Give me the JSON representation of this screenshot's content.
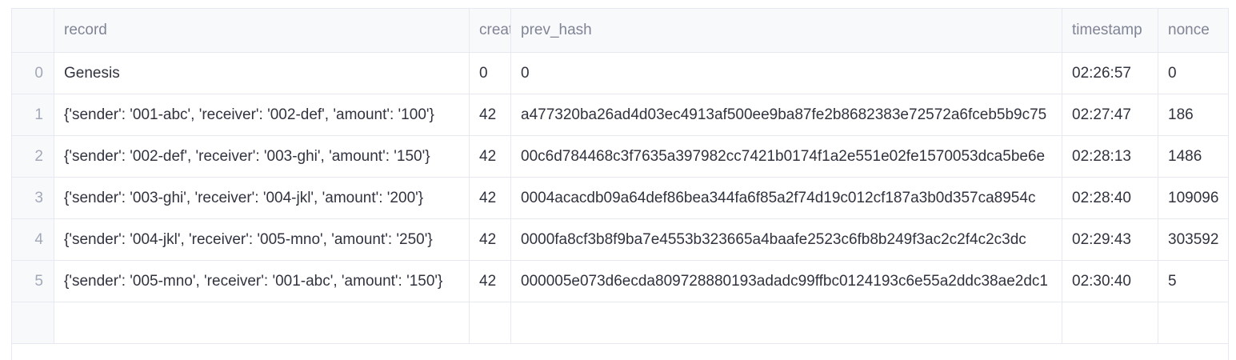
{
  "columns": [
    "",
    "record",
    "creat",
    "prev_hash",
    "timestamp",
    "nonce"
  ],
  "rows": [
    {
      "index": "0",
      "record": "Genesis",
      "creator": "0",
      "prev_hash": "0",
      "timestamp": "02:26:57",
      "nonce": "0"
    },
    {
      "index": "1",
      "record": "{'sender': '001-abc', 'receiver': '002-def', 'amount': '100'}",
      "creator": "42",
      "prev_hash": "a477320ba26ad4d03ec4913af500ee9ba87fe2b8682383e72572a6fceb5b9c75",
      "timestamp": "02:27:47",
      "nonce": "186"
    },
    {
      "index": "2",
      "record": "{'sender': '002-def', 'receiver': '003-ghi', 'amount': '150'}",
      "creator": "42",
      "prev_hash": "00c6d784468c3f7635a397982cc7421b0174f1a2e551e02fe1570053dca5be6e",
      "timestamp": "02:28:13",
      "nonce": "1486"
    },
    {
      "index": "3",
      "record": "{'sender': '003-ghi', 'receiver': '004-jkl', 'amount': '200'}",
      "creator": "42",
      "prev_hash": "0004acacdb09a64def86bea344fa6f85a2f74d19c012cf187a3b0d357ca8954c",
      "timestamp": "02:28:40",
      "nonce": "109096"
    },
    {
      "index": "4",
      "record": "{'sender': '004-jkl', 'receiver': '005-mno', 'amount': '250'}",
      "creator": "42",
      "prev_hash": "0000fa8cf3b8f9ba7e4553b323665a4baafe2523c6fb8b249f3ac2c2f4c2c3dc",
      "timestamp": "02:29:43",
      "nonce": "303592"
    },
    {
      "index": "5",
      "record": "{'sender': '005-mno', 'receiver': '001-abc', 'amount': '150'}",
      "creator": "42",
      "prev_hash": "000005e073d6ecda809728880193adadc99ffbc0124193c6e55a2ddc38ae2dc1",
      "timestamp": "02:30:40",
      "nonce": "5"
    }
  ]
}
